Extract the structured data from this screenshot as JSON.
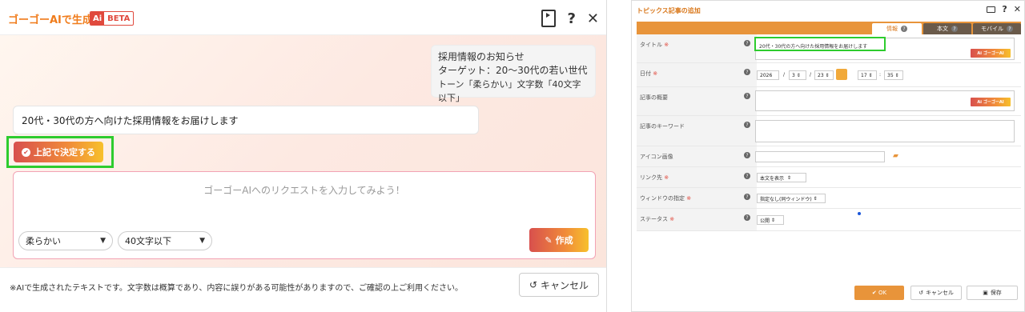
{
  "left_panel": {
    "title": "ゴーゴーAIで生成",
    "badge_ai": "Ai",
    "badge_beta": "BETA",
    "help_icon": "?",
    "close_icon": "✕",
    "bubble_line1": "採用情報のお知らせ",
    "bubble_line2": "ターゲット：20〜30代の若い世代",
    "bubble_line3": "トーン「柔らかい」文字数「40文字以下」",
    "generated_text": "20代・30代の方へ向けた採用情報をお届けします",
    "decide_button": "上記で決定する",
    "request_placeholder": "ゴーゴーAIへのリクエストを入力してみよう！",
    "tone_select": "柔らかい",
    "length_select": "40文字以下",
    "generate_button": "作成",
    "note": "※AIで生成されたテキストです。文字数は概算であり、内容に誤りがある可能性がありますので、ご確認の上ご利用ください。",
    "cancel_button": "キャンセル"
  },
  "right_panel": {
    "title": "トピックス記事の追加",
    "help_icon": "?",
    "close_icon": "✕",
    "tabs": [
      {
        "label": "情報",
        "active": true
      },
      {
        "label": "本文",
        "active": false
      },
      {
        "label": "モバイル",
        "active": false
      }
    ],
    "required_mark": "※",
    "fields": {
      "title_label": "タイトル",
      "title_value": "20代・30代の方へ向けた採用情報をお届けします",
      "date_label": "日付",
      "year": "2026",
      "month": "3",
      "day": "23",
      "hour": "17",
      "minute": "35",
      "date_sep": "/",
      "time_sep": ":",
      "summary_label": "記事の概要",
      "keyword_label": "記事のキーワード",
      "icon_label": "アイコン画像",
      "link_label": "リンク先",
      "link_value": "本文を表示",
      "window_label": "ウィンドウの指定",
      "window_value": "指定なし(同ウィンドウ)",
      "status_label": "ステータス",
      "status_value": "公開"
    },
    "ai_badge_prefix": "Ai",
    "ai_badge_label": "ゴーゴーAI",
    "ok_button": "OK",
    "cancel_button": "キャンセル",
    "save_button": "保存"
  },
  "colors": {
    "accent_orange": "#e8943a",
    "ai_gradient_start": "#d8504d",
    "ai_gradient_end": "#f7c02c",
    "highlight_green": "#2ecc2e"
  }
}
